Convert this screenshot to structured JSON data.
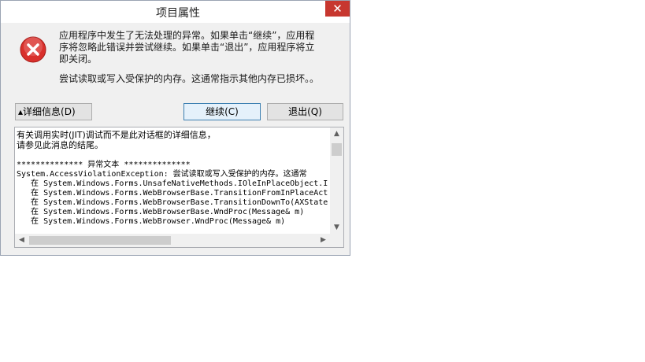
{
  "dialog": {
    "title": "项目属性",
    "close_glyph": "✕",
    "message_lines": [
      "应用程序中发生了无法处理的异常。如果单击“继续”，应用程",
      "序将忽略此错误并尝试继续。如果单击“退出”，应用程序将立",
      "即关闭。"
    ],
    "message2": "尝试读取或写入受保护的内存。这通常指示其他内存已损坏。。",
    "buttons": {
      "details": "▴详细信息(D)",
      "continue": "继续(C)",
      "quit": "退出(Q)"
    },
    "details": {
      "intro_lines": [
        "有关调用实时(JIT)调试而不是此对话框的详细信息，",
        "请参见此消息的结尾。"
      ],
      "exception_header": "************** 异常文本 **************",
      "exception_lines": [
        "System.AccessViolationException: 尝试读取或写入受保护的内存。这通常",
        "   在 System.Windows.Forms.UnsafeNativeMethods.IOleInPlaceObject.I",
        "   在 System.Windows.Forms.WebBrowserBase.TransitionFromInPlaceAct",
        "   在 System.Windows.Forms.WebBrowserBase.TransitionDownTo(AXState",
        "   在 System.Windows.Forms.WebBrowserBase.WndProc(Message& m)",
        "   在 System.Windows.Forms.WebBrowser.WndProc(Message& m)"
      ]
    },
    "icon": "error-icon",
    "colors": {
      "close_bg": "#c7372f",
      "error_red": "#d9302c",
      "default_border": "#3c7fb1"
    }
  }
}
